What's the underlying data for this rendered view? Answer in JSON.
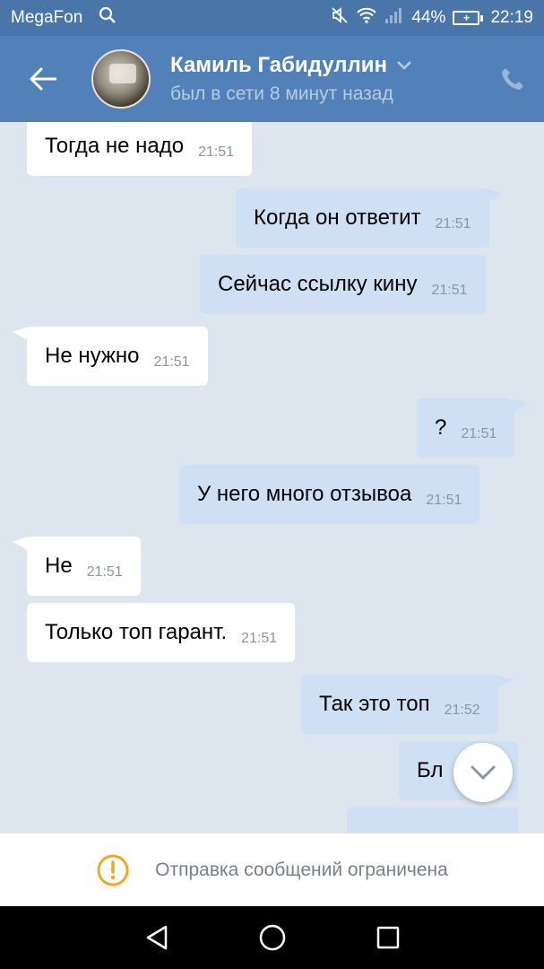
{
  "status_bar": {
    "carrier": "MegaFon",
    "battery": "44%",
    "time": "22:19"
  },
  "header": {
    "contact_name": "Камиль Габидуллин",
    "last_seen": "был в сети 8 минут назад"
  },
  "messages": [
    {
      "direction": "in",
      "text": "Тогда не надо",
      "time": "21:51"
    },
    {
      "direction": "out",
      "text": "Когда он ответит",
      "time": "21:51"
    },
    {
      "direction": "out",
      "text": "Сейчас ссылку кину",
      "time": "21:51"
    },
    {
      "direction": "in",
      "text": "Не нужно",
      "time": "21:51"
    },
    {
      "direction": "out",
      "text": "?",
      "time": "21:51"
    },
    {
      "direction": "out",
      "text": "У него много отзывоа",
      "time": "21:51"
    },
    {
      "direction": "in",
      "text": "Не",
      "time": "21:51"
    },
    {
      "direction": "in",
      "text": "Только топ гарант.",
      "time": "21:51"
    },
    {
      "direction": "out",
      "text": "Так это топ",
      "time": "21:52"
    },
    {
      "direction": "out",
      "text": "Бл",
      "time": ""
    }
  ],
  "restricted_notice": "Отправка сообщений ограничена",
  "colors": {
    "header": "#5181b8",
    "outgoing_bubble": "#cfe0f4",
    "incoming_bubble": "#ffffff",
    "warning": "#f5a623"
  }
}
